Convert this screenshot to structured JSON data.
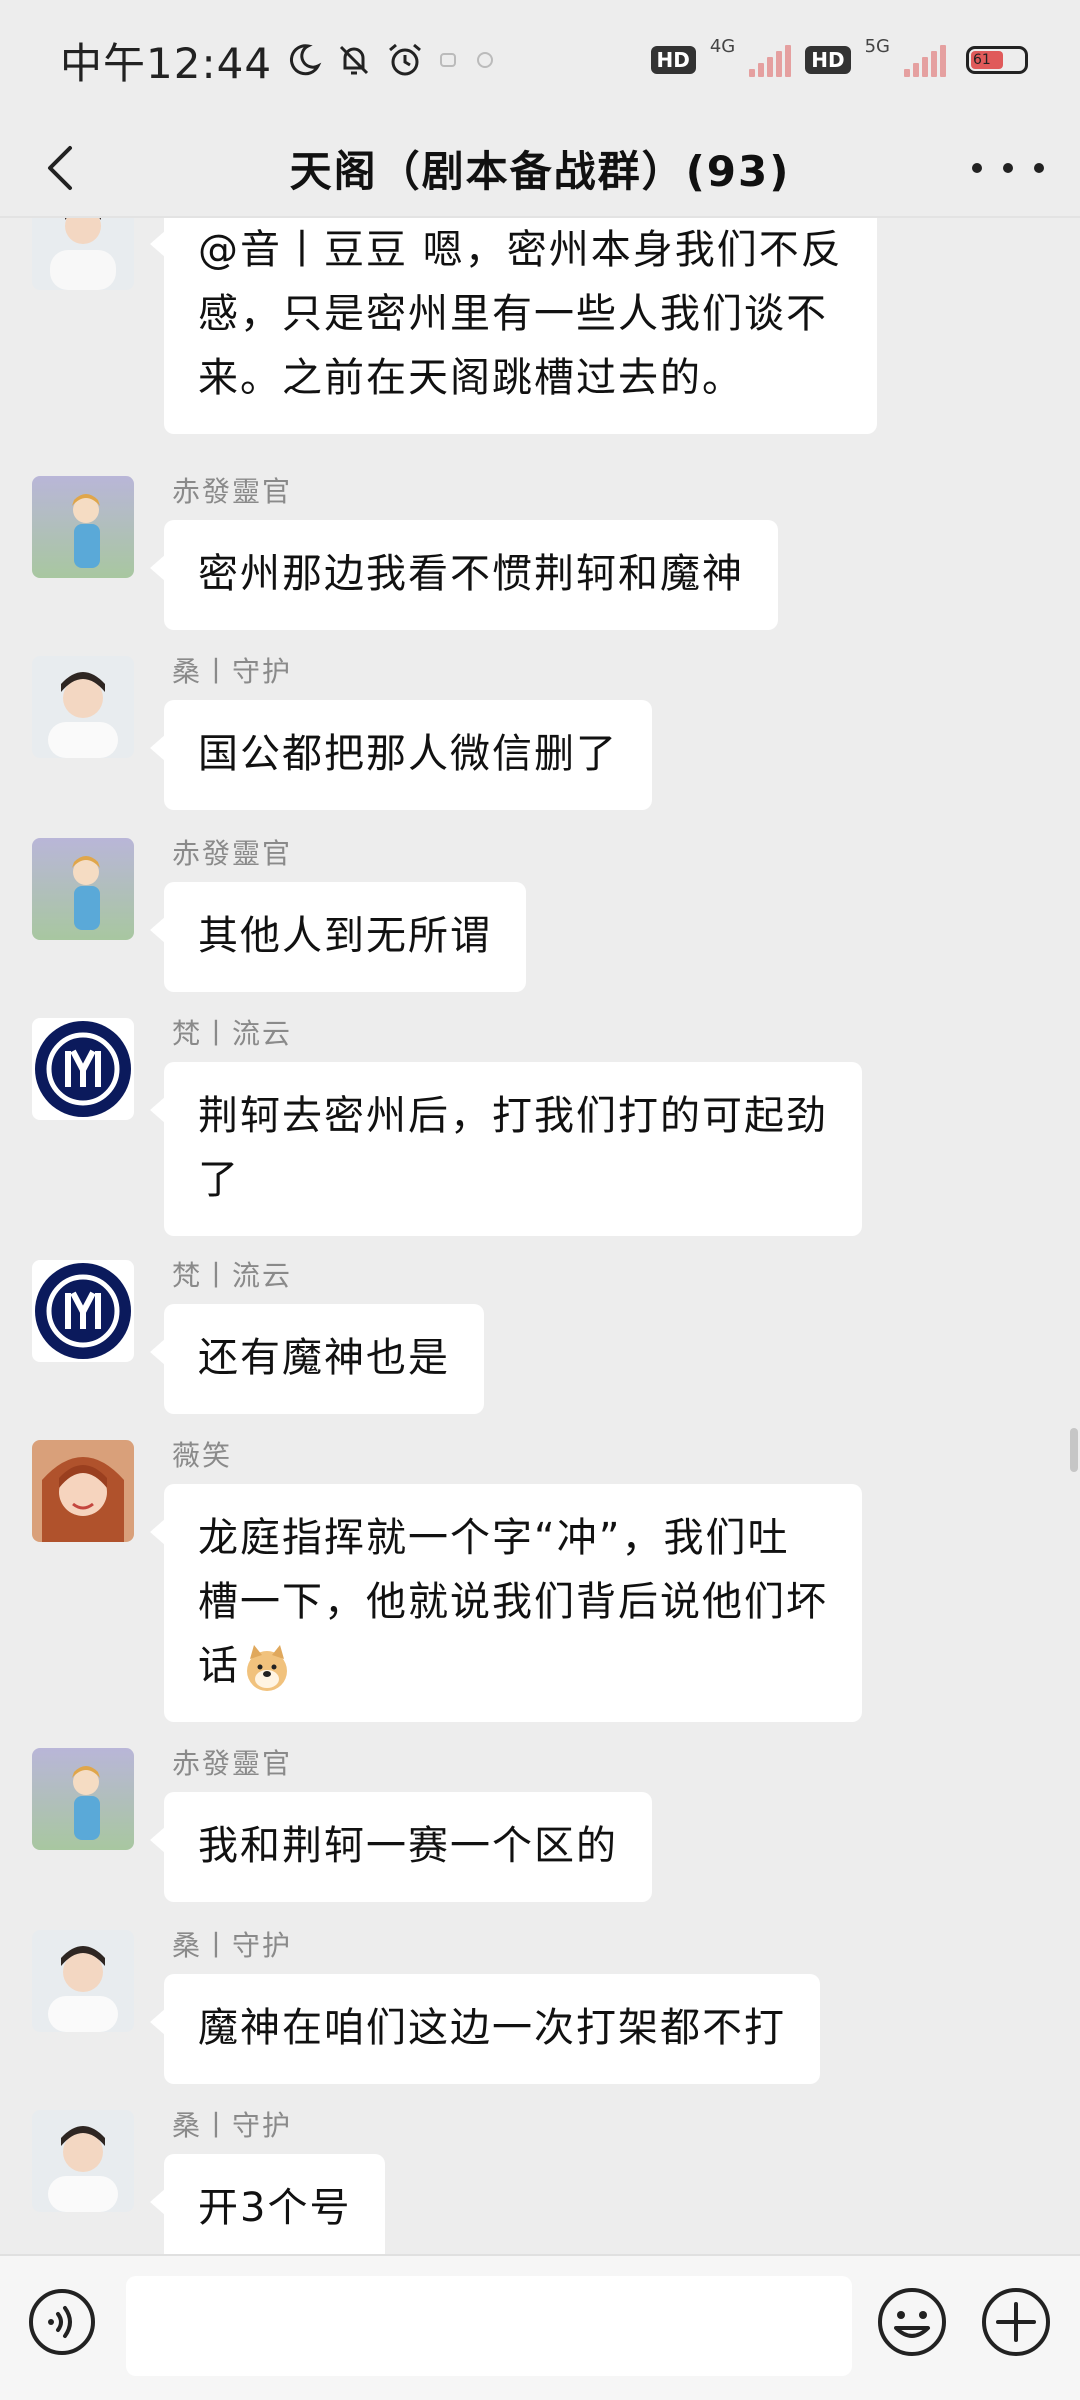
{
  "status_bar": {
    "time": "中午12:44",
    "network_1": "4G",
    "network_2": "5G",
    "hd_1": "HD",
    "hd_2": "HD",
    "battery_level": "61"
  },
  "header": {
    "title": "天阁（剧本备战群）(93)"
  },
  "messages": [
    {
      "sender": "",
      "lines": [
        "@音丨豆豆  嗯，密州本身我们不反",
        "感，只是密州里有一些人我们谈不",
        "来。之前在天阁跳槽过去的。"
      ]
    },
    {
      "sender": "赤發靈官",
      "lines": [
        "密州那边我看不惯荆轲和魔神"
      ]
    },
    {
      "sender": "桑丨守护",
      "lines": [
        "国公都把那人微信删了"
      ]
    },
    {
      "sender": "赤發靈官",
      "lines": [
        "其他人到无所谓"
      ]
    },
    {
      "sender": "梵丨流云",
      "lines": [
        "荆轲去密州后，打我们打的可起劲",
        "了"
      ]
    },
    {
      "sender": "梵丨流云",
      "lines": [
        "还有魔神也是"
      ]
    },
    {
      "sender": "薇笑",
      "lines": [
        "龙庭指挥就一个字“冲”，我们吐",
        "槽一下，他就说我们背后说他们坏",
        "话"
      ]
    },
    {
      "sender": "赤發靈官",
      "lines": [
        "我和荆轲一赛一个区的"
      ]
    },
    {
      "sender": "桑丨守护",
      "lines": [
        "魔神在咱们这边一次打架都不打"
      ]
    },
    {
      "sender": "桑丨守护",
      "lines": [
        "开3个号"
      ]
    }
  ],
  "icons": {
    "back": "chevron-left-icon",
    "more": "more-dots-icon",
    "voice": "voice-icon",
    "emoji": "emoji-icon",
    "add": "plus-icon"
  },
  "colors": {
    "background": "#ededed",
    "bubble": "#ffffff",
    "sender_name": "#8a8a8a"
  }
}
